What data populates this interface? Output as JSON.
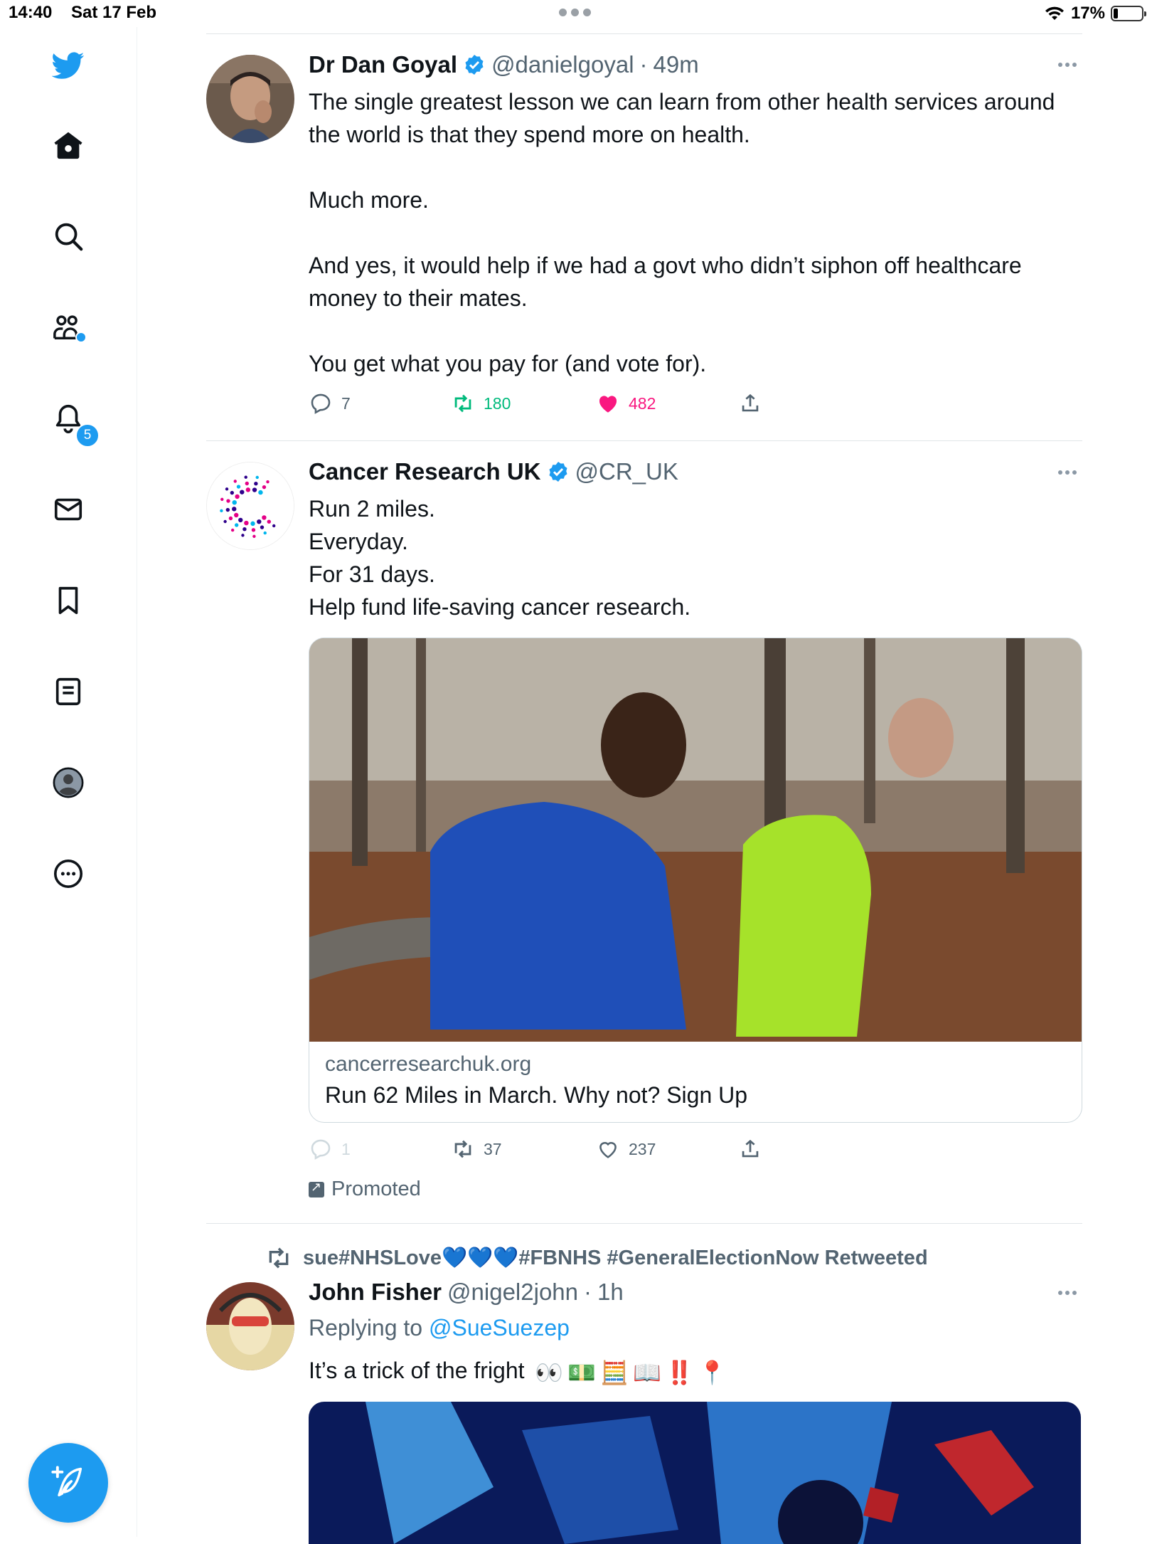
{
  "status_bar": {
    "time": "14:40",
    "date": "Sat 17 Feb",
    "battery": "17%",
    "battery_level": 0.17
  },
  "sidebar": {
    "items": [
      {
        "icon": "twitter-bird-icon"
      },
      {
        "icon": "home-icon"
      },
      {
        "icon": "search-icon"
      },
      {
        "icon": "communities-icon"
      },
      {
        "icon": "bell-icon"
      },
      {
        "icon": "mail-icon"
      },
      {
        "icon": "bookmark-icon"
      },
      {
        "icon": "lists-icon"
      },
      {
        "icon": "profile-icon"
      },
      {
        "icon": "more-icon"
      }
    ],
    "notifications_badge": "5",
    "compose_icon": "compose-tweet-icon"
  },
  "colors": {
    "accent": "#1d9bf0",
    "like": "#f91880",
    "retweet": "#00ba7c",
    "text": "#0f1419",
    "muted": "#536471"
  },
  "tweets": [
    {
      "name": "Dr Dan Goyal",
      "handle": "@danielgoyal",
      "time": "49m",
      "paragraphs": [
        "The single greatest lesson we can learn from other health services around the world is that they spend more on health.",
        "Much more.",
        "And yes, it would help if we had a govt who didn’t siphon off healthcare money to their mates.",
        "You get what you pay for (and vote for)."
      ],
      "replies": "7",
      "retweets": "180",
      "likes": "482"
    },
    {
      "name": "Cancer Research UK",
      "handle": "@CR_UK",
      "lines": [
        "Run 2 miles.",
        "Everyday.",
        "For 31 days.",
        "Help fund life-saving cancer research."
      ],
      "card": {
        "domain": "cancerresearchuk.org",
        "title": "Run 62 Miles in March. Why not? Sign Up"
      },
      "replies": "1",
      "retweets": "37",
      "likes": "237",
      "promoted": "Promoted"
    },
    {
      "retweeted_by": "sue#NHSLove💙💙💙#FBNHS #GeneralElectionNow Retweeted",
      "name": "John Fisher",
      "handle": "@nigel2john",
      "time": "1h",
      "replying_prefix": "Replying to",
      "replying_to": "@SueSuezep",
      "text": "It’s a trick of the fright",
      "emojis": [
        "👀",
        "💵",
        "🧮",
        "📖",
        "‼️",
        "📍"
      ]
    }
  ]
}
